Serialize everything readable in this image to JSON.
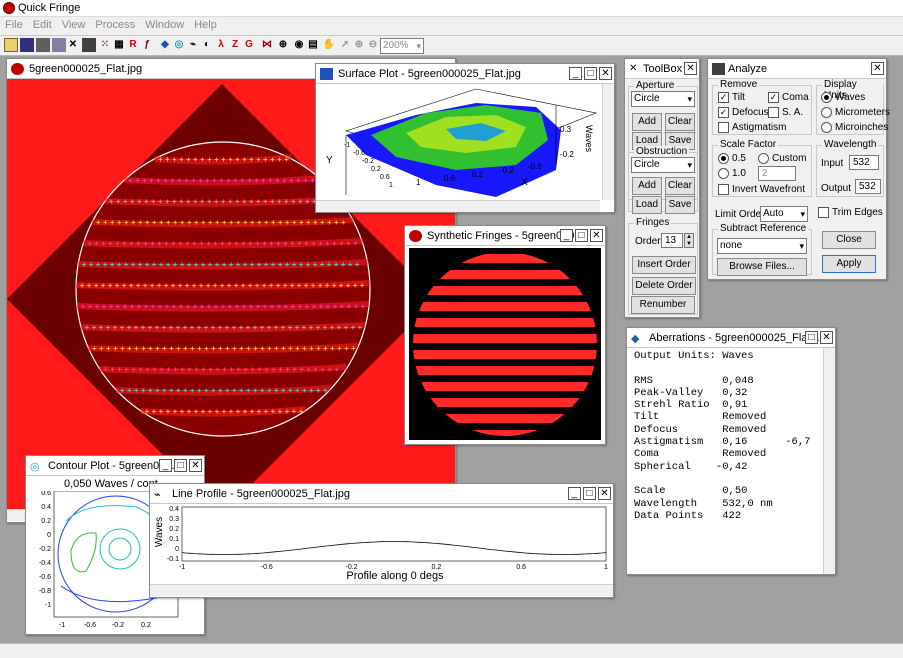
{
  "app": {
    "title": "Quick Fringe"
  },
  "menu": [
    "File",
    "Edit",
    "View",
    "Process",
    "Window",
    "Help"
  ],
  "toolbar": {
    "zoom": "200%"
  },
  "image_window": {
    "title": "5green000025_Flat.jpg"
  },
  "surface_window": {
    "title": "Surface Plot - 5green000025_Flat.jpg",
    "y_label": "Y",
    "x_label": "X",
    "z_label": "Waves",
    "x_ticks": [
      "1",
      "0.6",
      "0.2",
      "-0.2",
      "-0.6"
    ],
    "y_ticks": [
      "-1",
      "-0.6",
      "-0.2",
      "0.2",
      "0.6",
      "1"
    ],
    "z_ticks": [
      "0.3",
      "-0.2"
    ]
  },
  "synthetic_window": {
    "title": "Synthetic Fringes - 5green000..."
  },
  "toolbox": {
    "title": "ToolBox",
    "aperture": {
      "label": "Aperture",
      "shape": "Circle",
      "add": "Add",
      "clear": "Clear",
      "load": "Load",
      "save": "Save"
    },
    "obstruction": {
      "label": "Obstruction",
      "shape": "Circle",
      "add": "Add",
      "clear": "Clear",
      "load": "Load",
      "save": "Save"
    },
    "fringes": {
      "label": "Fringes",
      "order_label": "Order",
      "order_value": "13",
      "insert": "Insert Order",
      "delete": "Delete Order",
      "renumber": "Renumber"
    }
  },
  "analyze": {
    "title": "Analyze",
    "remove": {
      "label": "Remove",
      "tilt": "Tilt",
      "coma": "Coma",
      "defocus": "Defocus",
      "sa": "S. A.",
      "astig": "Astigmatism"
    },
    "display_units": {
      "label": "Display Units",
      "waves": "Waves",
      "micrometers": "Micrometers",
      "microinches": "Microinches"
    },
    "scale": {
      "label": "Scale Factor",
      "v05": "0.5",
      "custom": "Custom",
      "v10": "1.0",
      "custom_value": "2",
      "invert": "Invert Wavefront"
    },
    "wavelength": {
      "label": "Wavelength",
      "input_label": "Input",
      "input_value": "532",
      "output_label": "Output",
      "output_value": "532"
    },
    "limit_order": {
      "label": "Limit Order",
      "value": "Auto"
    },
    "trim_edges": "Trim Edges",
    "subtract": {
      "label": "Subtract Reference",
      "value": "none",
      "browse": "Browse Files..."
    },
    "close": "Close",
    "apply": "Apply"
  },
  "aberrations": {
    "title": "Aberrations - 5green000025_Flat...",
    "lines": [
      "Output Units: Waves",
      "",
      "RMS           0,048",
      "Peak-Valley   0,32",
      "Strehl Ratio  0,91",
      "Tilt          Removed",
      "Defocus       Removed",
      "Astigmatism   0,16      -6,7",
      "Coma          Removed",
      "Spherical    -0,42",
      "",
      "Scale         0,50",
      "Wavelength    532,0 nm",
      "Data Points   422"
    ]
  },
  "contour": {
    "title": "Contour Plot - 5green000...",
    "subtitle": "0,050 Waves / cont",
    "ticks": [
      "-1",
      "-0.6",
      "-0.2",
      "0.2"
    ],
    "yticks": [
      "0.6",
      "0.4",
      "0.2",
      "0",
      "-0.2",
      "-0.4",
      "-0.6",
      "-0.8",
      "-1"
    ]
  },
  "line_profile": {
    "title": "Line Profile - 5green000025_Flat.jpg",
    "ylabel": "Waves",
    "xlabel": "Profile along 0 degs",
    "yticks": [
      "0.4",
      "0.3",
      "0.2",
      "0.1",
      "0",
      "-0.1"
    ],
    "xticks": [
      "-1",
      "-0.6",
      "-0.2",
      "0.2",
      "0.6",
      "1"
    ]
  },
  "colors": {
    "fringe_red": "#ff1a1a",
    "dark_red": "#5a0000",
    "bg_gray": "#a0a0a0"
  }
}
